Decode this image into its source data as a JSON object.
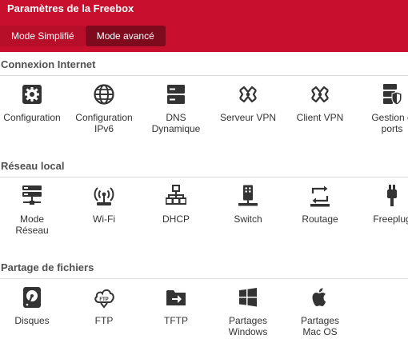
{
  "header": {
    "title": "Paramètres de la Freebox",
    "bg_color": "#c8102e",
    "tabs": [
      {
        "label": "Mode Simplifié",
        "active": false
      },
      {
        "label": "Mode avancé",
        "active": true
      }
    ]
  },
  "sections": [
    {
      "title": "Connexion Internet",
      "items": [
        {
          "label": "Configuration",
          "icon": "gear-icon"
        },
        {
          "label": "Configuration\nIPv6",
          "icon": "globe-icon"
        },
        {
          "label": "DNS\nDynamique",
          "icon": "server-icon"
        },
        {
          "label": "Serveur VPN",
          "icon": "vpn-icon"
        },
        {
          "label": "Client VPN",
          "icon": "vpn-icon"
        },
        {
          "label": "Gestion d\nports",
          "icon": "port-shield-icon"
        }
      ]
    },
    {
      "title": "Réseau local",
      "items": [
        {
          "label": "Mode\nRéseau",
          "icon": "network-mode-icon"
        },
        {
          "label": "Wi-Fi",
          "icon": "wifi-antenna-icon"
        },
        {
          "label": "DHCP",
          "icon": "dhcp-network-icon"
        },
        {
          "label": "Switch",
          "icon": "switch-tower-icon"
        },
        {
          "label": "Routage",
          "icon": "routing-icon"
        },
        {
          "label": "Freeplug",
          "icon": "plug-icon"
        }
      ]
    },
    {
      "title": "Partage de fichiers",
      "items": [
        {
          "label": "Disques",
          "icon": "disk-icon"
        },
        {
          "label": "FTP",
          "icon": "ftp-cloud-icon"
        },
        {
          "label": "TFTP",
          "icon": "tftp-folder-icon"
        },
        {
          "label": "Partages\nWindows",
          "icon": "windows-icon"
        },
        {
          "label": "Partages\nMac OS",
          "icon": "apple-icon"
        }
      ]
    }
  ]
}
